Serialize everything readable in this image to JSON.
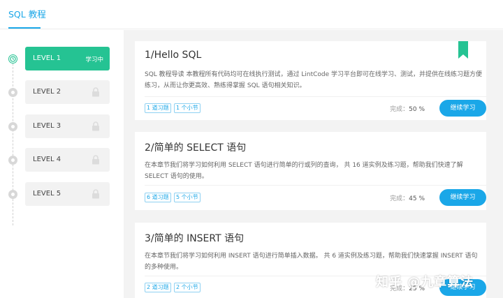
{
  "nav": {
    "tab": "SQL 教程"
  },
  "sidebar": {
    "levels": [
      {
        "label": "LEVEL 1",
        "status": "学习中",
        "active": true
      },
      {
        "label": "LEVEL 2",
        "locked": true
      },
      {
        "label": "LEVEL 3",
        "locked": true
      },
      {
        "label": "LEVEL 4",
        "locked": true
      },
      {
        "label": "LEVEL 5",
        "locked": true
      }
    ]
  },
  "cards": [
    {
      "title": "1/Hello SQL",
      "desc": "SQL 教程导读 本教程所有代码均可在线执行测试，通过 LintCode 学习平台即可在线学习、测试，并提供在线练习题方便练习，从而让你更高效、熟练得掌握 SQL 语句相关知识。",
      "tag_exercises": "1 道习题",
      "tag_sections": "1 个小节",
      "progress_label": "完成：",
      "progress_value": "50 %",
      "button": "继续学习"
    },
    {
      "title": "2/简单的 SELECT 语句",
      "desc": "在本章节我们将学习如何利用 SELECT 语句进行简单的行或列的查询， 共 16 道实例及练习题，帮助我们快速了解 SELECT 语句的使用。",
      "tag_exercises": "6 道习题",
      "tag_sections": "5 个小节",
      "progress_label": "完成：",
      "progress_value": "45 %",
      "button": "继续学习"
    },
    {
      "title": "3/简单的 INSERT 语句",
      "desc": "在本章节我们将学习如何利用 INSERT 语句进行简单插入数据。 共 6 道实例及练习题，帮助我们快速掌握 INSERT 语句的多种使用。",
      "tag_exercises": "2 道习题",
      "tag_sections": "2 个小节",
      "progress_label": "完成：",
      "progress_value": "25 %",
      "button": "继续学习"
    }
  ],
  "watermark": "知乎 @九章算法",
  "colors": {
    "accent": "#1aa7e8",
    "active_level": "#25c393",
    "main_bg": "#f3f3f3"
  }
}
